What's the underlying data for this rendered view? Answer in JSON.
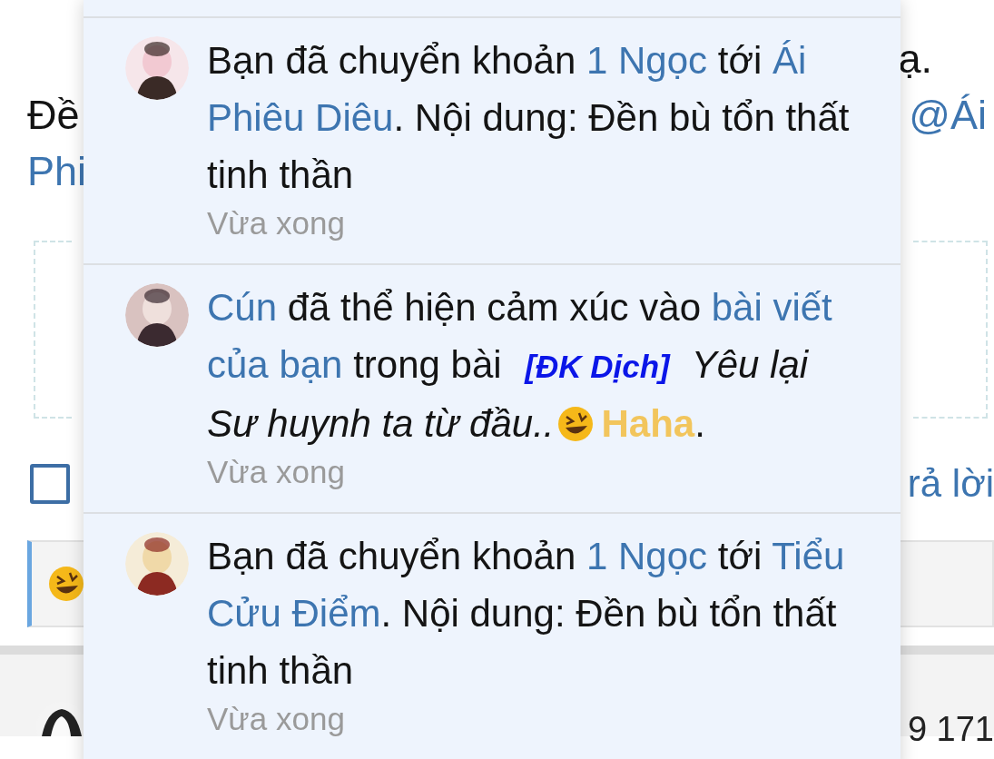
{
  "page": {
    "line_1_end": "ạ.",
    "line_2_start": "Đề",
    "line_2_end": "@Ái",
    "line_3_start": "Phi",
    "reply_checkbox": {
      "checked": false
    },
    "reply_link": "rả lời",
    "bottom_text": "9 171"
  },
  "notifications": [
    {
      "parts": [
        {
          "kind": "text",
          "text": "Bạn đã chuyển khoản "
        },
        {
          "kind": "link",
          "text": "1 Ngọc"
        },
        {
          "kind": "text",
          "text": " tới "
        },
        {
          "kind": "link",
          "text": "Ái Phiêu Diêu"
        },
        {
          "kind": "text",
          "text": ". Nội dung: Đền bù tổn thất tinh thần"
        }
      ],
      "time": "Vừa xong"
    },
    {
      "parts": [
        {
          "kind": "link",
          "text": "Cún"
        },
        {
          "kind": "text",
          "text": " đã thể hiện cảm xúc vào "
        },
        {
          "kind": "link",
          "text": "bài viết của bạn"
        },
        {
          "kind": "text",
          "text": " trong bài "
        },
        {
          "kind": "tag",
          "text": "[ĐK Dịch]"
        },
        {
          "kind": "italic",
          "text": "Yêu lại Sư huynh ta từ đầu.."
        },
        {
          "kind": "emoji"
        },
        {
          "kind": "reaction",
          "text": "Haha"
        },
        {
          "kind": "text",
          "text": "."
        }
      ],
      "time": "Vừa xong"
    },
    {
      "parts": [
        {
          "kind": "text",
          "text": "Bạn đã chuyển khoản "
        },
        {
          "kind": "link",
          "text": "1 Ngọc"
        },
        {
          "kind": "text",
          "text": " tới "
        },
        {
          "kind": "link",
          "text": "Tiểu Cửu Điểm"
        },
        {
          "kind": "text",
          "text": ". Nội dung: Đền bù tổn thất tinh thần"
        }
      ],
      "time": "Vừa xong"
    }
  ]
}
